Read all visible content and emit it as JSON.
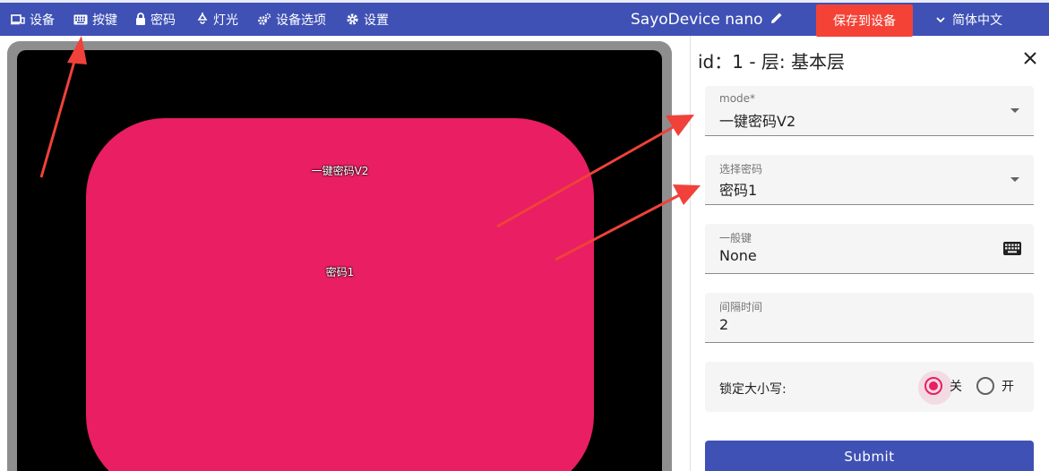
{
  "topbar": {
    "nav": [
      {
        "label": "设备",
        "icon": "devices-icon"
      },
      {
        "label": "按键",
        "icon": "keyboard-icon"
      },
      {
        "label": "密码",
        "icon": "lock-icon"
      },
      {
        "label": "灯光",
        "icon": "lightbulb-icon"
      },
      {
        "label": "设备选项",
        "icon": "gears-icon"
      },
      {
        "label": "设置",
        "icon": "gear-icon"
      }
    ],
    "device_name": "SayoDevice nano",
    "save_label": "保存到设备",
    "language": "简体中文"
  },
  "preview": {
    "key_lines": [
      "一键密码V2",
      "密码1"
    ]
  },
  "panel": {
    "title": "id：1 - 层: 基本层",
    "fields": {
      "mode": {
        "label": "mode*",
        "value": "一键密码V2"
      },
      "password": {
        "label": "选择密码",
        "value": "密码1"
      },
      "normal_key": {
        "label": "一般键",
        "value": "None"
      },
      "interval": {
        "label": "间隔时间",
        "value": "2"
      }
    },
    "caps_lock": {
      "label": "锁定大小写:",
      "options": [
        "关",
        "开"
      ],
      "selected": "关"
    },
    "submit_label": "Submit"
  },
  "colors": {
    "primary": "#3f51b5",
    "accent": "#e91e63",
    "save": "#f44336",
    "arrow": "#f0413a"
  }
}
